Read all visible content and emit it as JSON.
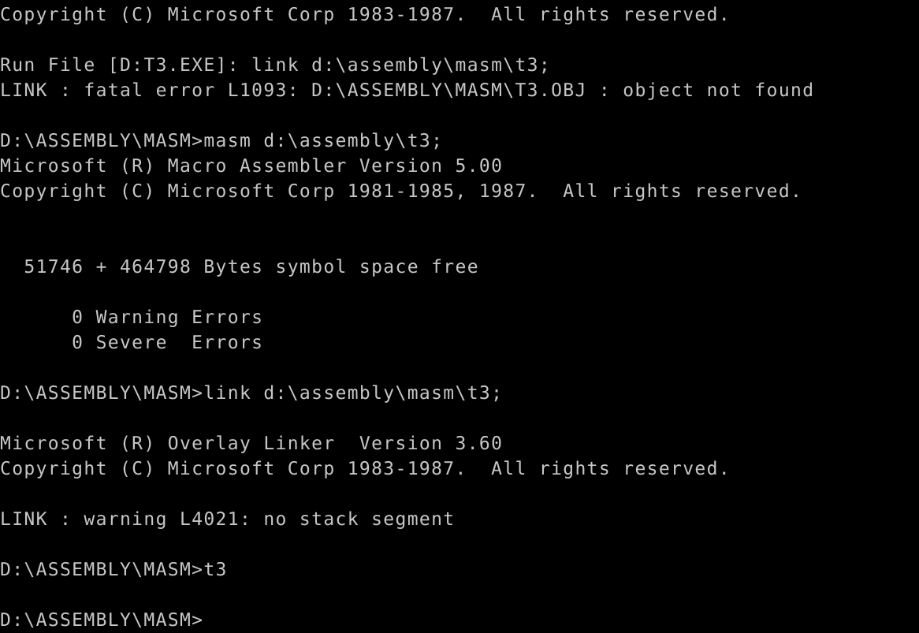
{
  "terminal": {
    "type": "dos-console",
    "background_color": "#000000",
    "text_color": "#c6c6c6",
    "columns": 72,
    "rows": 25,
    "prompt": "D:\\ASSEMBLY\\MASM>",
    "cursor_visible": false,
    "lines": [
      "Copyright (C) Microsoft Corp 1983-1987.  All rights reserved.",
      "",
      "Run File [D:T3.EXE]: link d:\\assembly\\masm\\t3;",
      "LINK : fatal error L1093: D:\\ASSEMBLY\\MASM\\T3.OBJ : object not found",
      "",
      "D:\\ASSEMBLY\\MASM>masm d:\\assembly\\t3;",
      "Microsoft (R) Macro Assembler Version 5.00",
      "Copyright (C) Microsoft Corp 1981-1985, 1987.  All rights reserved.",
      "",
      "",
      "  51746 + 464798 Bytes symbol space free",
      "",
      "      0 Warning Errors",
      "      0 Severe  Errors",
      "",
      "D:\\ASSEMBLY\\MASM>link d:\\assembly\\masm\\t3;",
      "",
      "Microsoft (R) Overlay Linker  Version 3.60",
      "Copyright (C) Microsoft Corp 1983-1987.  All rights reserved.",
      "",
      "LINK : warning L4021: no stack segment",
      "",
      "D:\\ASSEMBLY\\MASM>t3",
      "",
      "D:\\ASSEMBLY\\MASM>"
    ]
  }
}
